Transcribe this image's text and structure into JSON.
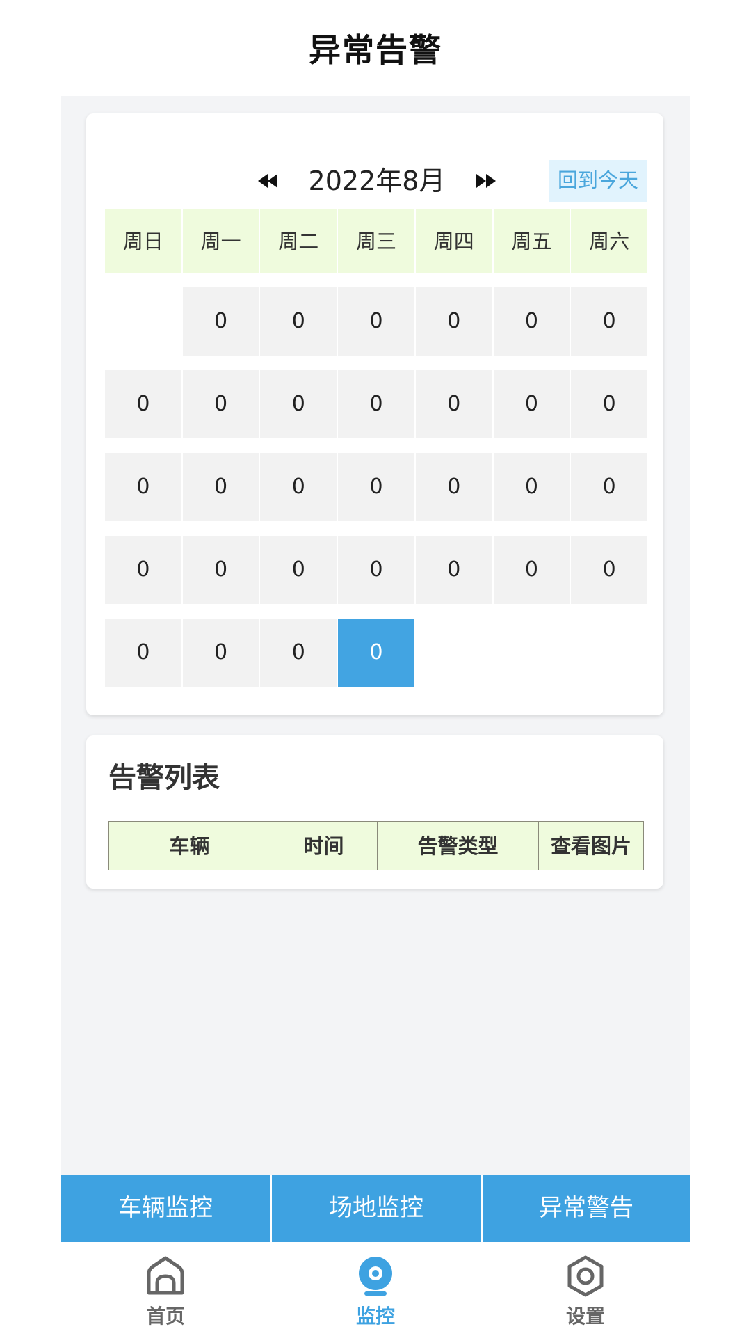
{
  "header": {
    "title": "异常告警"
  },
  "calendar": {
    "month_label": "2022年8月",
    "today_button": "回到今天",
    "weekdays": [
      "周日",
      "周一",
      "周二",
      "周三",
      "周四",
      "周五",
      "周六"
    ],
    "weeks": [
      [
        "",
        "0",
        "0",
        "0",
        "0",
        "0",
        "0"
      ],
      [
        "0",
        "0",
        "0",
        "0",
        "0",
        "0",
        "0"
      ],
      [
        "0",
        "0",
        "0",
        "0",
        "0",
        "0",
        "0"
      ],
      [
        "0",
        "0",
        "0",
        "0",
        "0",
        "0",
        "0"
      ],
      [
        "0",
        "0",
        "0",
        "0",
        "",
        "",
        ""
      ]
    ],
    "today_color": "#42a4e2"
  },
  "alert_list": {
    "title": "告警列表",
    "columns": [
      "车辆",
      "时间",
      "告警类型",
      "查看图片"
    ]
  },
  "tabs": [
    {
      "label": "车辆监控"
    },
    {
      "label": "场地监控"
    },
    {
      "label": "异常警告"
    }
  ],
  "bottom_nav": [
    {
      "label": "首页",
      "icon": "home-icon"
    },
    {
      "label": "监控",
      "icon": "camera-icon"
    },
    {
      "label": "设置",
      "icon": "settings-icon"
    }
  ],
  "colors": {
    "accent": "#3ea2e1",
    "header_bg": "#effbdd",
    "today_bg": "#e1f3fd",
    "page_bg": "#f3f4f6"
  }
}
